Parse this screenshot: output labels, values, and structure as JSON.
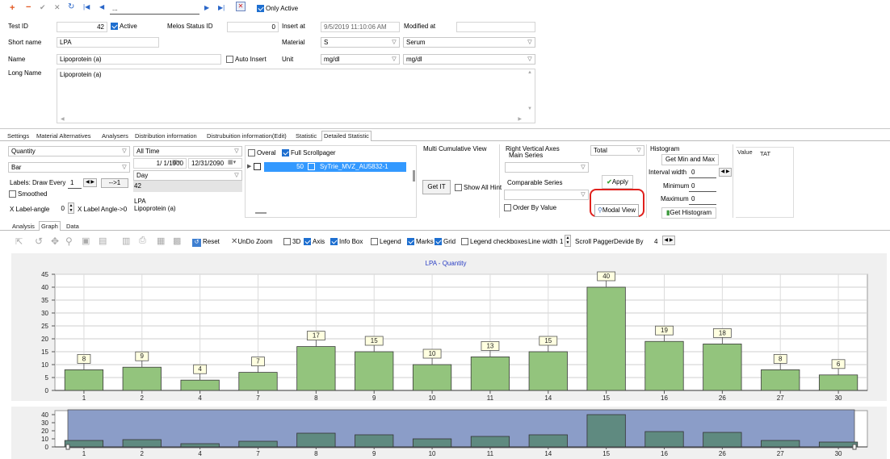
{
  "nav": {
    "search_value": "...",
    "only_active_label": "Only Active"
  },
  "test": {
    "test_id_label": "Test ID",
    "test_id_value": "42",
    "active_label": "Active",
    "melos_label": "Melos Status ID",
    "melos_value": "0",
    "insert_at_label": "Insert at",
    "insert_at_value": "9/5/2019 11:10:06 AM",
    "modified_at_label": "Modified at",
    "modified_at_value": "",
    "short_name_label": "Short name",
    "short_name_value": "LPA",
    "material_label": "Material",
    "material_code": "S",
    "material_name": "Serum",
    "name_label": "Name",
    "name_value": "Lipoprotein (a)",
    "auto_insert_label": "Auto Insert",
    "unit_label": "Unit",
    "unit_code": "mg/dl",
    "unit_name": "mg/dl",
    "long_name_label": "Long Name",
    "long_name_value": "Lipoprotein (a)"
  },
  "tabs": [
    "Settings",
    "Material Alternatives",
    "Analysers",
    "Distribution information",
    "Distrubuition information(Edit)",
    "Statistic",
    "Detailed Statistic"
  ],
  "ds": {
    "quantity": "Quantity",
    "chart_kind": "Bar",
    "labels_draw_every": "Labels: Draw Every",
    "draw_every_value": "1",
    "arrow_one": "-->1",
    "smoothed": "Smoothed",
    "x_label_angle": "X Label-angle",
    "x_label_angle_value": "0",
    "x_label_angle_arrow": "X Label Angle->0",
    "time_range": "All Time",
    "date_from": "1/ 1/1900",
    "date_to": "12/31/2090",
    "period": "Day",
    "list_values": [
      "42",
      "LPA",
      "Lipoprotein (a)"
    ],
    "overal": "Overal",
    "full_scrollpager": "Full Scrollpager",
    "row_count": "50",
    "row_name": "SyTrie_MVZ_AU5832-1",
    "multi_cumulative": "Multi Cumulative View",
    "get_it": "Get IT",
    "show_all_hint": "Show All Hint",
    "right_vertical_axes": "Right Vertical Axes",
    "main_series": "Main Series",
    "comparable_series": "Comparable Series",
    "order_by_value": "Order By Value",
    "total": "Total",
    "apply": "Apply",
    "modal_view": "Modal View",
    "histogram": "Histogram",
    "get_min_max": "Get Min and Max",
    "interval_width": "Interval width",
    "interval_width_value": "0",
    "minimum": "Minimum",
    "minimum_value": "0",
    "maximum": "Maximum",
    "maximum_value": "0",
    "get_histogram": "Get Histogram",
    "value_tab": "Value",
    "tat_tab": "TAT"
  },
  "subtabs": [
    "Analysis",
    "Graph",
    "Data"
  ],
  "toolbar": {
    "reset": "Reset",
    "undo_zoom": "UnDo Zoom",
    "c3d": "3D",
    "axis": "Axis",
    "info_box": "Info Box",
    "legend": "Legend",
    "marks": "Marks",
    "grid": "Grid",
    "legend_checkboxes": "Legend checkboxes",
    "line_width": "Line width",
    "line_width_value": "1",
    "scroll_pager": "Scroll PaggerDevide By",
    "scroll_pager_value": "4"
  },
  "colors": {
    "bar_fill": "#93c47d",
    "bar_stroke": "#3a3a3a",
    "label_fill": "#ffffe0",
    "nav_bg": "#8b9dc8",
    "nav_bar": "#5f8a80",
    "title_color": "#2a3ec4",
    "highlight": "#e0201c",
    "tab_selected": "#3399ff"
  },
  "chart_data": {
    "type": "bar",
    "title": "LPA - Quantity",
    "categories": [
      "1",
      "2",
      "4",
      "7",
      "8",
      "9",
      "10",
      "11",
      "14",
      "15",
      "16",
      "26",
      "27",
      "30"
    ],
    "values": [
      8,
      9,
      4,
      7,
      17,
      15,
      10,
      13,
      15,
      40,
      19,
      18,
      8,
      6
    ],
    "ylim": [
      0,
      45
    ],
    "yticks": [
      0,
      5,
      10,
      15,
      20,
      25,
      30,
      35,
      40,
      45
    ],
    "nav_yticks": [
      0,
      10,
      20,
      30,
      40
    ],
    "grid": true,
    "legend": "none"
  }
}
